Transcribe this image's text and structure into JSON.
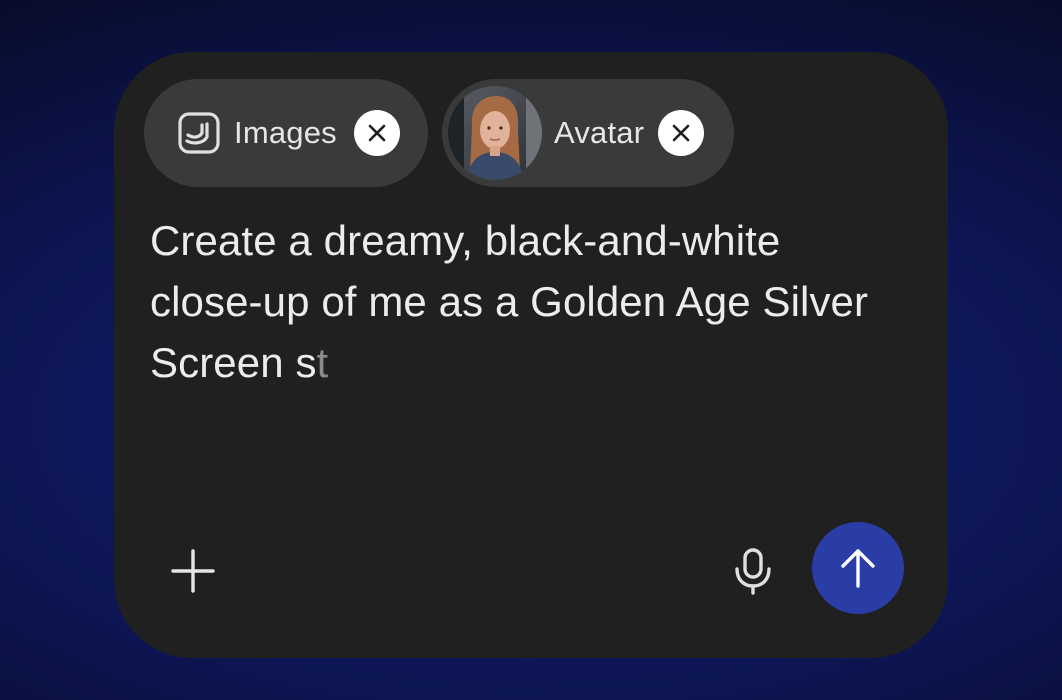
{
  "composer": {
    "chips": [
      {
        "label": "Images",
        "icon": "images-icon",
        "close_icon": "close-icon"
      },
      {
        "label": "Avatar",
        "icon": "avatar-photo",
        "close_icon": "close-icon"
      }
    ],
    "prompt_text": "Create a dreamy, black-and-white close-up of me as a Golden Age Silver Screen s",
    "prompt_ghost_text": "t",
    "actions": {
      "add_icon": "plus-icon",
      "mic_icon": "microphone-icon",
      "send_icon": "arrow-up-icon"
    }
  },
  "colors": {
    "send_button": "#2a3da6",
    "chip_background": "#3a3a3b",
    "composer_background": "#202020"
  }
}
